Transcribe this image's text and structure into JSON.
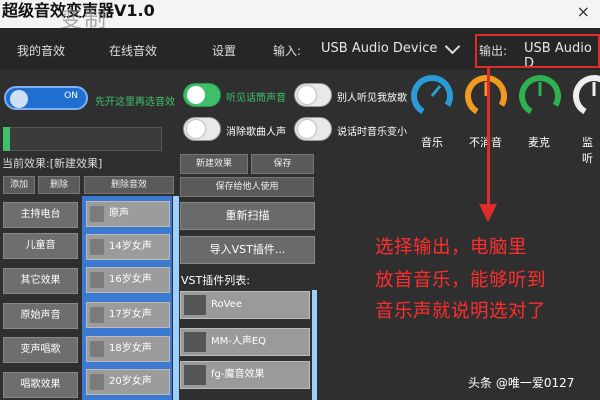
{
  "window": {
    "title": "超级音效变声器V1.0",
    "watermark": "变制",
    "close_glyph": "×"
  },
  "nav": {
    "my_effects": "我的音效",
    "online_effects": "在线音效",
    "settings": "设置"
  },
  "devices": {
    "input_label": "输入:",
    "input_value": "USB Audio Device",
    "output_label": "输出:",
    "output_value": "USB Audio D"
  },
  "options": {
    "master_toggle_text": "ON",
    "master_hint": "先开这里再选音效",
    "hear_voice": "听见话筒声音",
    "others_hear_playback": "别人听见我放歌",
    "remove_vocals": "消除歌曲人声",
    "lower_music_when_speaking": "说话时音乐变小"
  },
  "dials": [
    {
      "label": "音乐",
      "icon": "music-dial-icon",
      "color": "#2a9bd8"
    },
    {
      "label": "不消音",
      "icon": "no-mute-dial-icon",
      "color": "#f09a20"
    },
    {
      "label": "麦克",
      "icon": "mic-dial-icon",
      "color": "#2fb14f"
    },
    {
      "label": "监听",
      "icon": "monitor-dial-icon",
      "color": "#eeeeee"
    }
  ],
  "effects": {
    "header": "当前效果:[新建效果]",
    "add": "添加",
    "delete": "删除",
    "delete_effect": "删除音效",
    "categories": [
      "主持电台",
      "儿童音",
      "其它效果",
      "原始声音",
      "变声唱歌",
      "唱歌效果"
    ],
    "presets": [
      "原声",
      "14岁女声",
      "16岁女声",
      "17岁女声",
      "18岁女声",
      "20岁女声"
    ]
  },
  "actions": {
    "new_effect": "新建效果",
    "save": "保存",
    "save_for_others": "保存给他人使用",
    "rescan": "重新扫描",
    "import_vst": "导入VST插件..."
  },
  "vst": {
    "header": "VST插件列表:",
    "plugins": [
      "RoVee",
      "MM-人声EQ",
      "fg-魔音效果"
    ]
  },
  "annotation": {
    "lines": [
      "选择输出，电脑里",
      "放首音乐，能够听到",
      "音乐声就说明选对了"
    ],
    "color": "#ff2d2d"
  },
  "credit": "头条 @唯一爱0127",
  "colors": {
    "accent_blue": "#1f6fd1",
    "toggle_green": "#3ec06a",
    "annotation_red": "#e02b2b"
  }
}
